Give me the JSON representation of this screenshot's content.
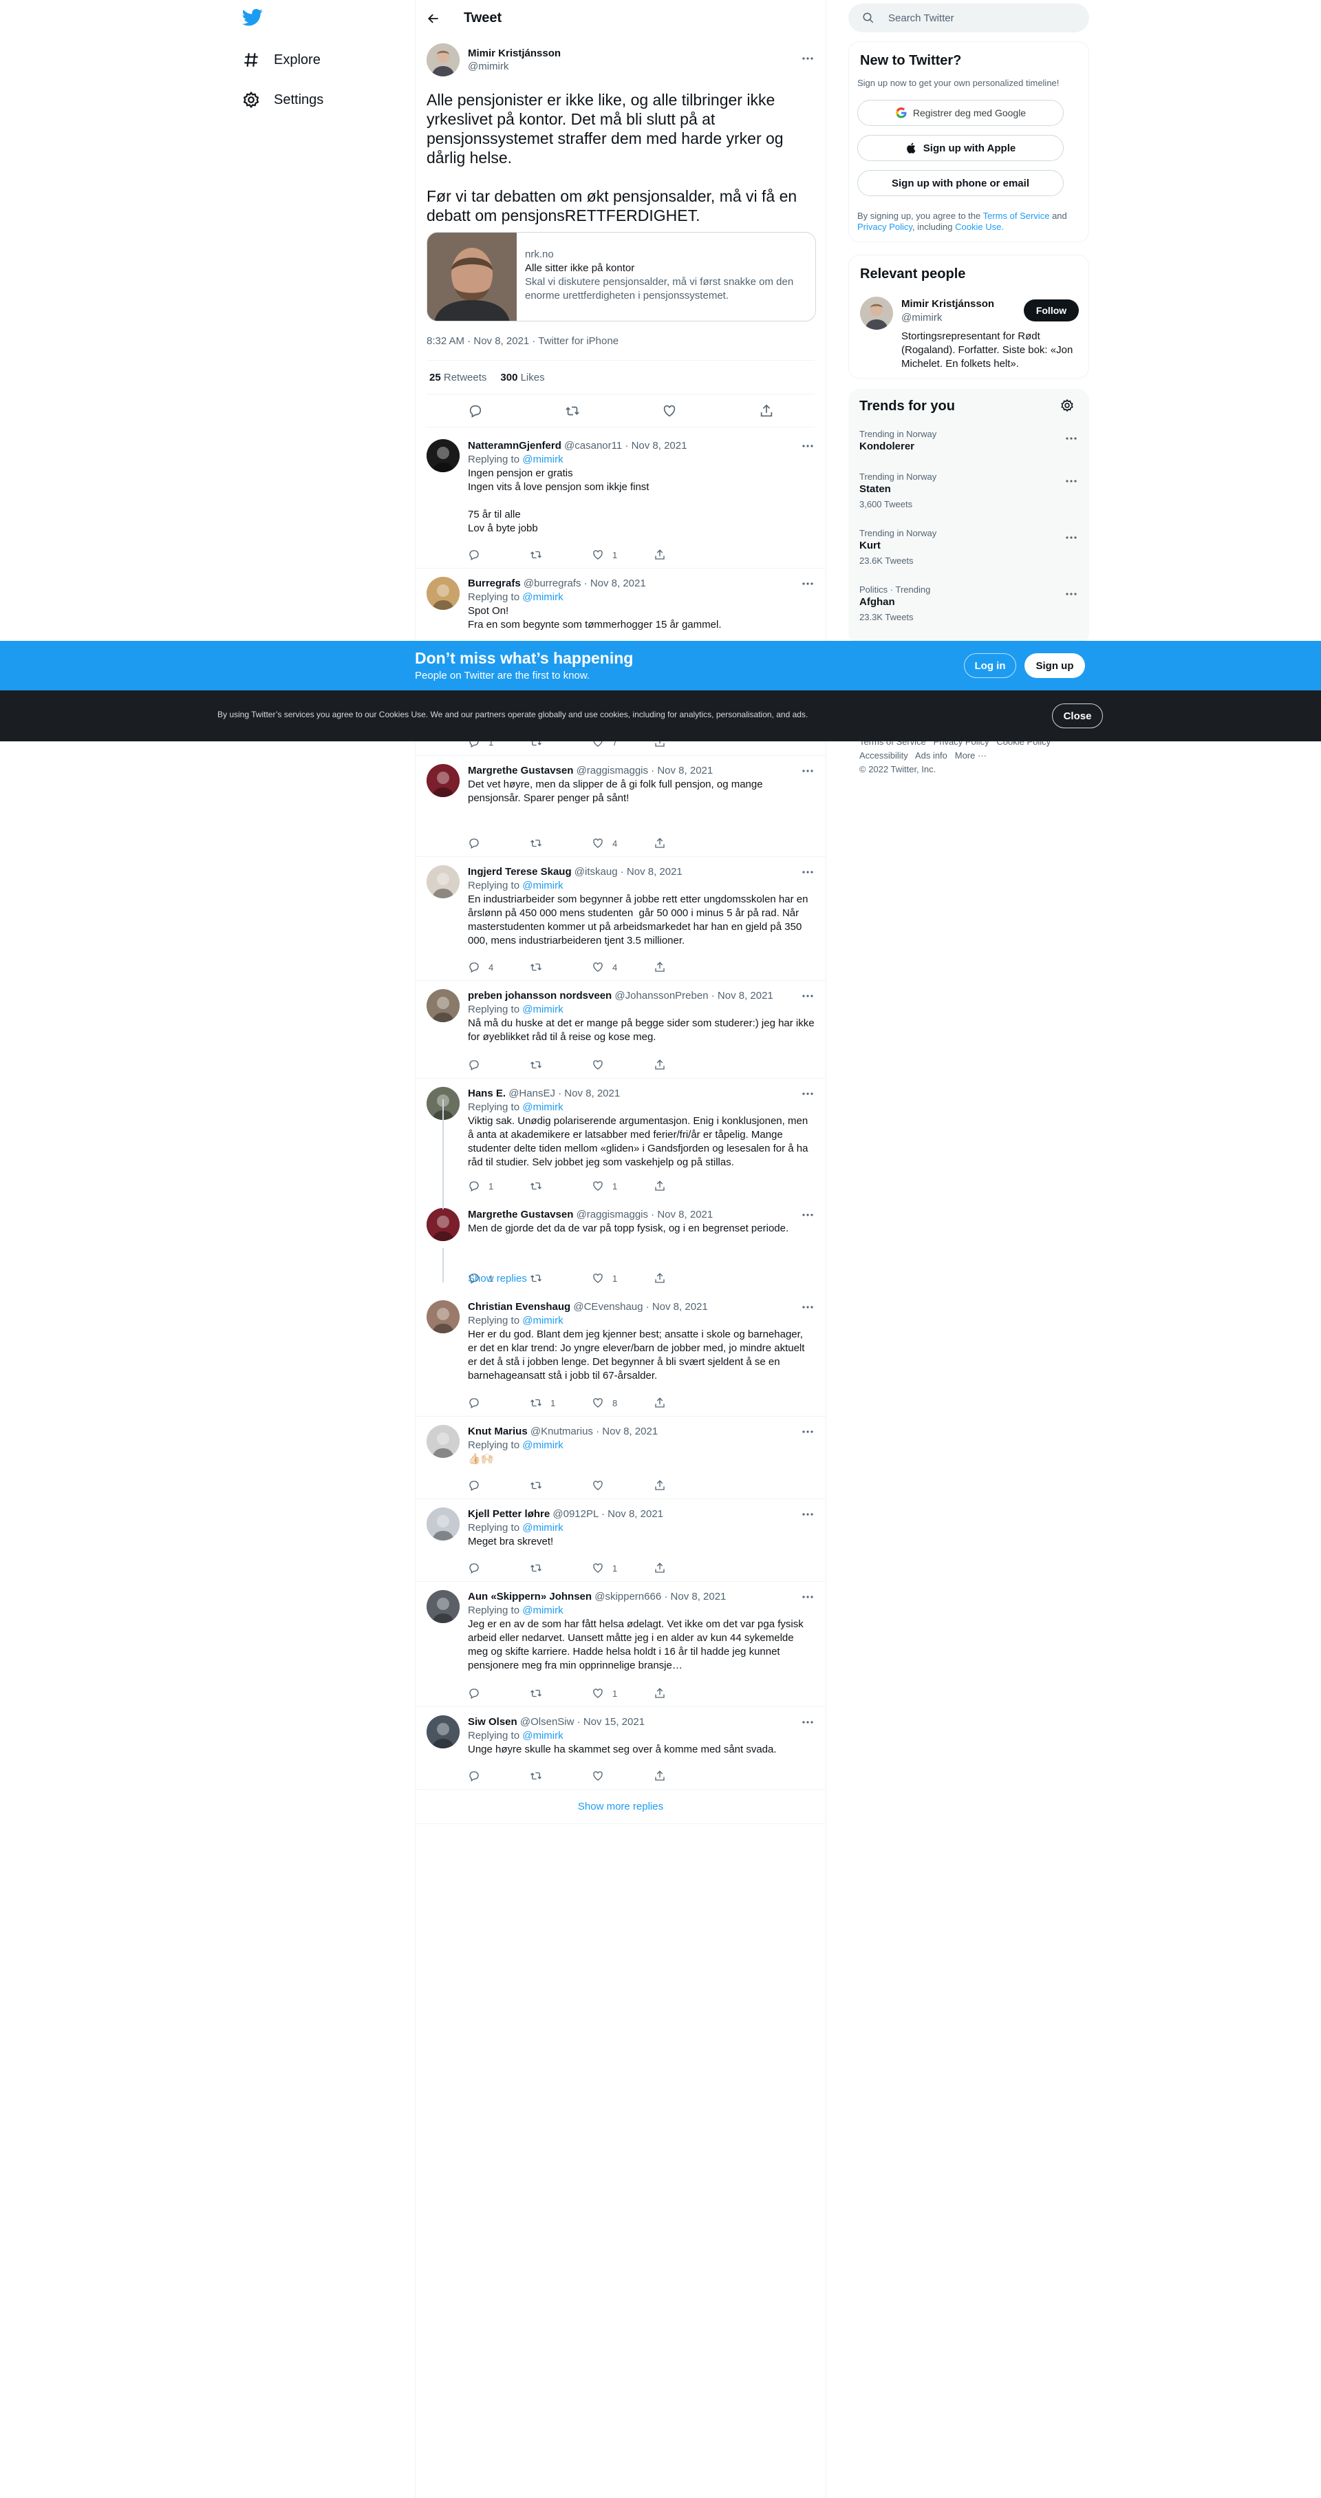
{
  "nav": {
    "explore": "Explore",
    "settings": "Settings"
  },
  "header": {
    "title": "Tweet"
  },
  "main_tweet": {
    "name": "Mimir Kristjánsson",
    "handle": "@mimirk",
    "text": "Alle pensjonister er ikke like, og alle tilbringer ikke yrkeslivet på kontor. Det må bli slutt på at pensjonssystemet straffer dem med harde yrker og dårlig helse.\n\nFør vi tar debatten om økt pensjonsalder, må vi få en debatt om pensjonsRETTFERDIGHET.",
    "card": {
      "domain": "nrk.no",
      "title": "Alle sitter ikke på kontor",
      "description": "Skal vi diskutere pensjonsalder, må vi først snakke om den enorme urettferdigheten i pensjonssystemet."
    },
    "meta": "8:32 AM · Nov 8, 2021 · Twitter for iPhone",
    "retweets": "25",
    "retweets_label": "Retweets",
    "likes": "300",
    "likes_label": "Likes"
  },
  "replies": [
    {
      "name": "NatteramnGjenferd",
      "handle": "@casanor11",
      "date": "Nov 8, 2021",
      "replying": "Replying to",
      "to": "@mimirk",
      "text": "Ingen pensjon er gratis\nIngen vits å love pensjon som ikkje finst\n\n75 år til alle\nLov å byte jobb",
      "reply_count": "",
      "rt_count": "",
      "like_count": "1"
    },
    {
      "name": "Burregrafs",
      "handle": "@burregrafs",
      "date": "Nov 8, 2021",
      "replying": "Replying to",
      "to": "@mimirk",
      "text": "Spot On!\nFra en som begynte som tømmerhogger 15 år gammel.",
      "reply_count": "1",
      "rt_count": "",
      "like_count": "7"
    },
    {
      "name": "Margrethe Gustavsen",
      "handle": "@raggismaggis",
      "date": "Nov 8, 2021",
      "replying": "",
      "to": "",
      "text": "Det vet høyre, men da slipper de å gi folk full pensjon, og mange pensjonsår. Sparer penger på sånt!",
      "reply_count": "",
      "rt_count": "",
      "like_count": "4"
    },
    {
      "name": "Ingjerd Terese Skaug",
      "handle": "@itskaug",
      "date": "Nov 8, 2021",
      "replying": "Replying to",
      "to": "@mimirk",
      "text": "En industriarbeider som begynner å jobbe rett etter ungdomsskolen har en årslønn på 450 000 mens studenten  går 50 000 i minus 5 år på rad. Når masterstudenten kommer ut på arbeidsmarkedet har han en gjeld på 350 000, mens industriarbeideren tjent 3.5 millioner.",
      "reply_count": "4",
      "rt_count": "",
      "like_count": "4"
    },
    {
      "name": "preben johansson nordsveen",
      "handle": "@JohanssonPreben",
      "date": "Nov 8, 2021",
      "replying": "Replying to",
      "to": "@mimirk",
      "text": "Nå må du huske at det er mange på begge sider som studerer:) jeg har ikke for øyeblikket råd til å reise og kose meg.",
      "reply_count": "",
      "rt_count": "",
      "like_count": ""
    },
    {
      "name": "Hans E.",
      "handle": "@HansEJ",
      "date": "Nov 8, 2021",
      "replying": "Replying to",
      "to": "@mimirk",
      "text": "Viktig sak. Unødig polariserende argumentasjon. Enig i konklusjonen, men å anta at akademikere er latsabber med ferier/fri/år er tåpelig. Mange studenter delte tiden mellom «gliden» i Gandsfjorden og lesesalen for å ha råd til studier. Selv jobbet jeg som vaskehjelp og på stillas.",
      "reply_count": "1",
      "rt_count": "",
      "like_count": "1"
    },
    {
      "name": "Margrethe Gustavsen",
      "handle": "@raggismaggis",
      "date": "Nov 8, 2021",
      "replying": "",
      "to": "",
      "text": "Men de gjorde det da de var på topp fysisk, og i en begrenset periode.",
      "reply_count": "1",
      "rt_count": "",
      "like_count": "1"
    },
    {
      "name": "Christian Evenshaug",
      "handle": "@CEvenshaug",
      "date": "Nov 8, 2021",
      "replying": "Replying to",
      "to": "@mimirk",
      "text": "Her er du god. Blant dem jeg kjenner best; ansatte i skole og barnehager, er det en klar trend: Jo yngre elever/barn de jobber med, jo mindre aktuelt er det å stå i jobben lenge. Det begynner å bli svært sjeldent å se en barnehageansatt stå i jobb til 67-årsalder.",
      "reply_count": "",
      "rt_count": "1",
      "like_count": "8"
    },
    {
      "name": "Knut Marius",
      "handle": "@Knutmarius",
      "date": "Nov 8, 2021",
      "replying": "Replying to",
      "to": "@mimirk",
      "text": "👍🏻🙌🏻",
      "reply_count": "",
      "rt_count": "",
      "like_count": ""
    },
    {
      "name": "Kjell Petter løhre",
      "handle": "@0912PL",
      "date": "Nov 8, 2021",
      "replying": "Replying to",
      "to": "@mimirk",
      "text": "Meget bra skrevet!",
      "reply_count": "",
      "rt_count": "",
      "like_count": "1"
    },
    {
      "name": "Aun «Skippern» Johnsen",
      "handle": "@skippern666",
      "date": "Nov 8, 2021",
      "replying": "Replying to",
      "to": "@mimirk",
      "text": "Jeg er en av de som har fått helsa ødelagt. Vet ikke om det var pga fysisk arbeid eller nedarvet. Uansett måtte jeg i en alder av kun 44 sykemelde meg og skifte karriere. Hadde helsa holdt i 16 år til hadde jeg kunnet pensjonere meg fra min opprinnelige bransje…",
      "reply_count": "",
      "rt_count": "",
      "like_count": "1"
    },
    {
      "name": "Siw Olsen",
      "handle": "@OlsenSiw",
      "date": "Nov 15, 2021",
      "replying": "Replying to",
      "to": "@mimirk",
      "text": "Unge høyre skulle ha skammet seg over å komme med sånt svada.",
      "reply_count": "",
      "rt_count": "",
      "like_count": ""
    }
  ],
  "show_replies": "Show replies",
  "show_more_replies": "Show more replies",
  "right": {
    "search_placeholder": "Search Twitter",
    "new_title": "New to Twitter?",
    "new_sub": "Sign up now to get your own personalized timeline!",
    "google_btn": "Registrer deg med Google",
    "apple_btn": "Sign up with Apple",
    "phone_btn": "Sign up with phone or email",
    "terms_1": "By signing up, you agree to the",
    "terms_link": "Terms of Service",
    "terms_2": "and",
    "privacy_link": "Privacy Policy",
    "terms_3": ", including",
    "cookie_link": "Cookie Use.",
    "relevant_title": "Relevant people",
    "person_name": "Mimir Kristjánsson",
    "person_handle": "@mimirk",
    "follow": "Follow",
    "person_bio": "Stortingsrepresentant for Rødt (Rogaland). Forfatter. Siste bok: «Jon Michelet. En folkets helt».",
    "trends_title": "Trends for you",
    "trends": [
      {
        "context": "Trending in Norway",
        "name": "Kondolerer",
        "count": ""
      },
      {
        "context": "Trending in Norway",
        "name": "Staten",
        "count": "3,600 Tweets"
      },
      {
        "context": "Trending in Norway",
        "name": "Kurt",
        "count": "23.6K Tweets"
      },
      {
        "context": "Politics · Trending",
        "name": "Afghan",
        "count": "23.3K Tweets"
      }
    ],
    "footer_1": "Terms of Service",
    "footer_2": "Privacy Policy",
    "footer_3": "Cookie Policy",
    "footer_4": "Accessibility",
    "footer_5": "Ads info",
    "footer_6": "More ···",
    "copyright": "© 2022 Twitter, Inc."
  },
  "banner": {
    "title": "Don’t miss what’s happening",
    "subtitle": "People on Twitter are the first to know.",
    "login": "Log in",
    "signup": "Sign up"
  },
  "cookie": {
    "text": "By using Twitter’s services you agree to our Cookies Use. We and our partners operate globally and use cookies, including for analytics, personalisation, and ads.",
    "close": "Close"
  },
  "colors": {
    "accent": "#1d9bf0",
    "text": "#0f1419",
    "muted": "#536471",
    "banner": "#1d9bf0",
    "cookie_bg": "#1a1d21"
  }
}
